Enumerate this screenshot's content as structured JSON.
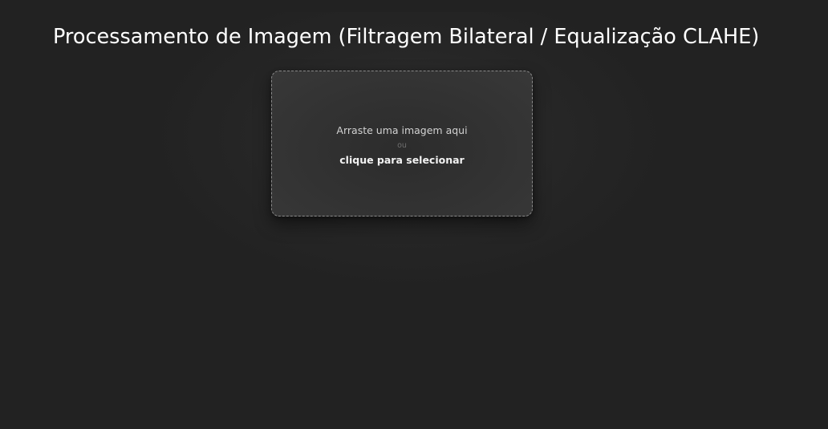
{
  "page": {
    "title": "Processamento de Imagem (Filtragem Bilateral / Equalização CLAHE)"
  },
  "dropzone": {
    "drag_text": "Arraste uma imagem aqui",
    "or_text": "ou",
    "click_text": "clique para selecionar"
  },
  "colors": {
    "background": "#222222",
    "dropzone_background": "#333333",
    "dropzone_border": "#8a8a8a",
    "title_text": "#ffffff",
    "secondary_text": "#d2d2d2",
    "muted_text": "#6f6f6f"
  }
}
